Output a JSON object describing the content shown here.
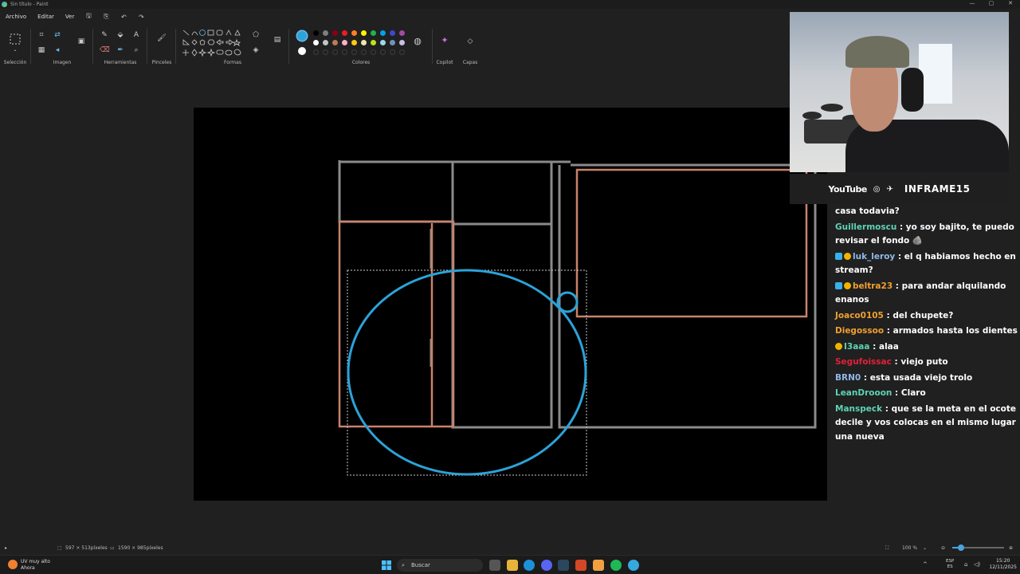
{
  "window": {
    "title": "Sin título - Paint",
    "controls": [
      "—",
      "▢",
      "✕"
    ]
  },
  "menu": {
    "file": "Archivo",
    "edit": "Editar",
    "view": "Ver"
  },
  "ribbon": {
    "selection": "Selección",
    "image": "Imagen",
    "tools": "Herramientas",
    "brushes": "Pinceles",
    "shapes": "Formas",
    "colors": "Colores",
    "copilot": "Copilot",
    "layers": "Capas"
  },
  "colors": {
    "primary": "#2ba3d8",
    "secondary": "#ffffff",
    "palette_row1": [
      "#000000",
      "#7f7f7f",
      "#880015",
      "#ed1c24",
      "#ff7f27",
      "#fff200",
      "#22b14c",
      "#00a2e8",
      "#3f48cc",
      "#a349a4"
    ],
    "palette_row2": [
      "#ffffff",
      "#c3c3c3",
      "#b97a57",
      "#ffaec9",
      "#ffc90e",
      "#efe4b0",
      "#b5e61d",
      "#99d9ea",
      "#7092be",
      "#c8bfe7"
    ],
    "line_gray": "#8a8a8a",
    "line_salmon": "#c9826a",
    "circle_blue": "#2ba3d8"
  },
  "stream": {
    "social_youtube": "YouTube",
    "brand": "INFRAME15"
  },
  "chat": [
    {
      "user": "",
      "user_color": "#ffffff",
      "badges": [],
      "message": "casa todavia?"
    },
    {
      "user": "Guillermoscu",
      "user_color": "#5fd3b3",
      "badges": [],
      "message": ": yo soy bajito, te puedo revisar el fondo 🪨"
    },
    {
      "user": "luk_leroy",
      "user_color": "#8fb8e8",
      "badges": [
        "gem",
        "gold"
      ],
      "message": ": el q habiamos hecho en stream?"
    },
    {
      "user": "beltra23",
      "user_color": "#f0a030",
      "badges": [
        "cube",
        "gift"
      ],
      "message": ": para andar alquilando enanos"
    },
    {
      "user": "Joaco0105",
      "user_color": "#f0a030",
      "badges": [],
      "message": ": del chupete?"
    },
    {
      "user": "Diegossoo",
      "user_color": "#f0a030",
      "badges": [],
      "message": ": armados hasta los dientes"
    },
    {
      "user": "I3aaa",
      "user_color": "#5fd3b3",
      "badges": [
        "gold"
      ],
      "message": ": alaa"
    },
    {
      "user": "Segufoissac",
      "user_color": "#e0203a",
      "badges": [],
      "message": ": viejo puto"
    },
    {
      "user": "BRN0",
      "user_color": "#8fb8e8",
      "badges": [],
      "message": ": esta usada viejo trolo"
    },
    {
      "user": "LeanDrooon",
      "user_color": "#5fd3b3",
      "badges": [],
      "message": ": Claro"
    },
    {
      "user": "Manspeck",
      "user_color": "#5fd3b3",
      "badges": [],
      "message": ": que se la meta en el ocote decile y vos colocas en el mismo lugar una nueva"
    }
  ],
  "status": {
    "selection_size": "597 × 513píxeles",
    "canvas_size": "1590 × 985píxeles",
    "zoom": "100 %",
    "zoom_fraction": 0.17
  },
  "taskbar": {
    "weather_title": "UV muy alto",
    "weather_sub": "Ahora",
    "search": "Buscar",
    "lang1": "ESP",
    "lang2": "ES",
    "time": "15:20",
    "date": "12/11/2025"
  }
}
